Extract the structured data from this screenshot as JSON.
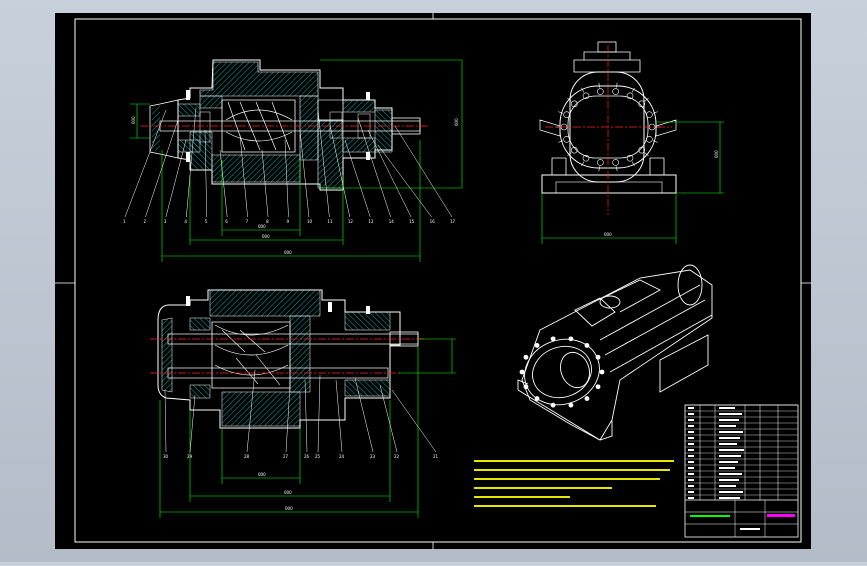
{
  "drawing": {
    "background": "#000000",
    "line_color": "#ffffff",
    "dim_color": "#00ff00",
    "hatch_color": "#00ffff",
    "center_color": "#ff0000",
    "note_color": "#ffff00",
    "title_accent": "#ff00ff"
  },
  "top_section_labels": [
    "1",
    "2",
    "3",
    "4",
    "5",
    "6",
    "7",
    "8",
    "9",
    "10",
    "11",
    "12",
    "13",
    "14",
    "15",
    "16",
    "17"
  ],
  "bottom_section_labels": [
    "30",
    "29",
    "28",
    "27",
    "26",
    "25",
    "24",
    "23",
    "22",
    "21"
  ]
}
